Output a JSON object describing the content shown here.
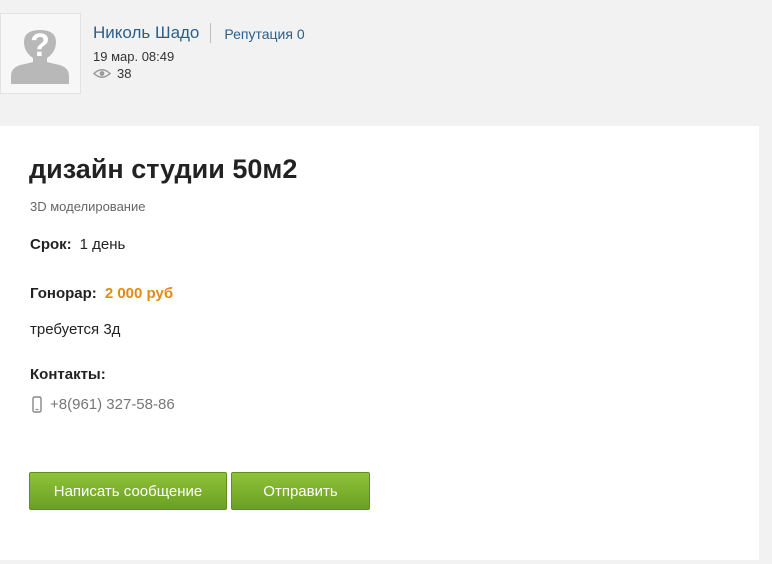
{
  "author": {
    "name": "Николь Шадо",
    "reputation": "Репутация 0",
    "date": "19 мар. 08:49",
    "views": "38"
  },
  "post": {
    "title": "дизайн студии 50м2",
    "category": "3D моделирование",
    "term_label": "Срок:",
    "term_value": "1 день",
    "fee_label": "Гонорар:",
    "fee_value": "2 000 руб",
    "description": "требуется 3д",
    "contacts_label": "Контакты:",
    "phone": "+8(961) 327-58-86"
  },
  "actions": {
    "message_label": "Написать сообщение",
    "send_label": "Отправить"
  },
  "colors": {
    "link": "#2a5f8a",
    "fee": "#e08b12",
    "button": "#7ab22d"
  },
  "icons": [
    "avatar-placeholder-icon",
    "eye-icon",
    "phone-icon"
  ]
}
